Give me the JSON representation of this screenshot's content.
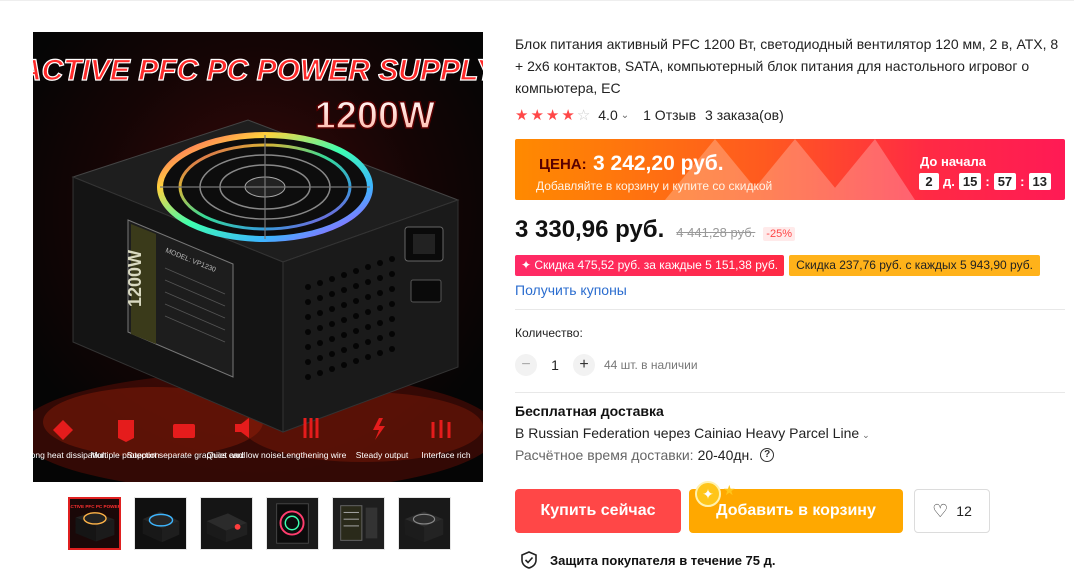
{
  "product": {
    "title": "Блок питания активный PFC 1200 Вт, светодиодный вентилятор 120 мм, 2 в, ATX, 8 + 2x6 контактов, SATA, компьютерный блок питания для настольного игровог о компьютера, ЕС",
    "rating": "4.0",
    "rating_value": 4.0,
    "reviews": "1 Отзыв",
    "orders": "3 заказа(ов)"
  },
  "image": {
    "banner_text": "ACTIVE PFC PC POWER SUPPLY",
    "wattage": "1200W",
    "side_text": "1200W",
    "model_label": "MODEL: VP1230",
    "features": [
      {
        "label": "Strong heat dissipation"
      },
      {
        "label": "Multiple protection"
      },
      {
        "label": "Support separate graphics card"
      },
      {
        "label": "Quiet and low noise"
      },
      {
        "label": "Lengthening wire"
      },
      {
        "label": "Steady output"
      },
      {
        "label": "Interface rich"
      }
    ]
  },
  "promo": {
    "label": "ЦЕНА:",
    "price": "3 242,20 руб.",
    "subtitle": "Добавляйте в корзину и купите со скидкой",
    "countdown_label": "До начала",
    "days": "2",
    "days_unit": "д.",
    "hours": "15",
    "minutes": "57",
    "seconds": "13"
  },
  "pricing": {
    "current": "3 330,96 руб.",
    "old": "4 441,28 руб.",
    "discount": "-25%"
  },
  "coupons": {
    "coupon1": "✦ Скидка 475,52 руб. за каждые 5 151,38 руб.",
    "coupon2": "Скидка 237,76 руб. с каждых 5 943,90 руб.",
    "get_link": "Получить купоны"
  },
  "quantity": {
    "label": "Количество:",
    "minus": "−",
    "value": "1",
    "plus": "+",
    "stock": "44 шт. в наличии"
  },
  "shipping": {
    "title": "Бесплатная доставка",
    "destination": "В Russian Federation через Cainiao Heavy Parcel Line",
    "eta_label": "Расчётное время доставки:",
    "eta_value": "20-40",
    "eta_unit": "дн."
  },
  "actions": {
    "buy_now": "Купить сейчас",
    "add_to_cart": "Добавить в корзину",
    "wishlist_count": "12"
  },
  "protection": {
    "text": "Защита покупателя в течение 75 д."
  },
  "colors": {
    "accent_red": "#ff4747",
    "accent_orange": "#ffa800",
    "link_blue": "#2b6dcf",
    "coupon_pink": "#ff2a55",
    "coupon_yellow": "#ffb21a"
  },
  "icons": [
    "star-icon",
    "chevron-down-icon",
    "question-icon",
    "heart-icon",
    "shield-check-icon",
    "sparkle-icon"
  ]
}
